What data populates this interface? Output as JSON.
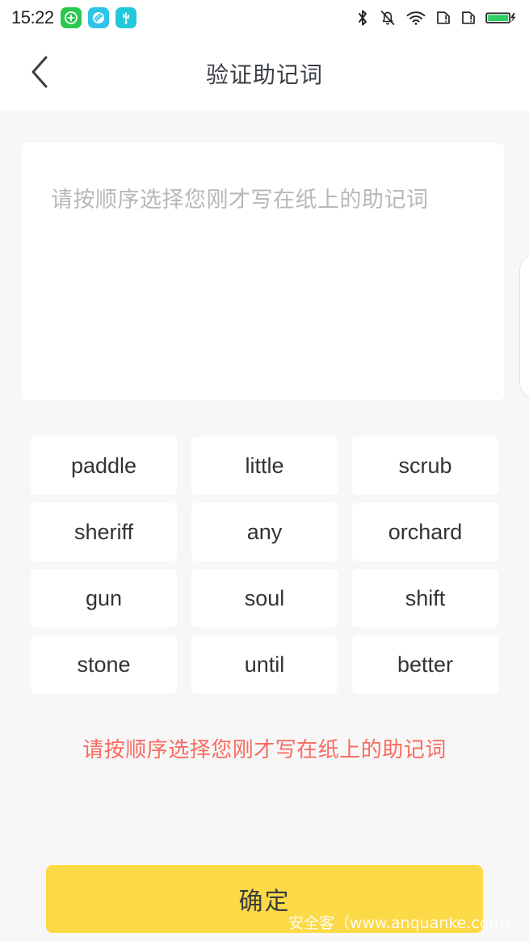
{
  "status_bar": {
    "clock": "15:22",
    "app_icons": [
      {
        "name": "security-shield-app-icon",
        "color": "#28c84f"
      },
      {
        "name": "browser-ball-app-icon",
        "color": "#2ec3e8"
      },
      {
        "name": "usb-debug-icon",
        "color": "#21c8d8"
      }
    ],
    "system_icons": [
      {
        "name": "bluetooth-icon"
      },
      {
        "name": "notifications-muted-icon"
      },
      {
        "name": "wifi-icon"
      },
      {
        "name": "sim1-alert-icon"
      },
      {
        "name": "sim2-alert-icon"
      },
      {
        "name": "battery-charging-icon",
        "color": "#2ecc62"
      }
    ]
  },
  "nav": {
    "back_label": "",
    "title": "验证助记词"
  },
  "selection": {
    "placeholder": "请按顺序选择您刚才写在纸上的助记词",
    "selected_words": []
  },
  "words": [
    "paddle",
    "little",
    "scrub",
    "sheriff",
    "any",
    "orchard",
    "gun",
    "soul",
    "shift",
    "stone",
    "until",
    "better"
  ],
  "error": {
    "message": "请按顺序选择您刚才写在纸上的助记词",
    "color": "#fa6a5f"
  },
  "confirm": {
    "label": "确定",
    "color": "#fcd947"
  },
  "watermark": {
    "text": "安全客（www.anquanke.com）"
  }
}
